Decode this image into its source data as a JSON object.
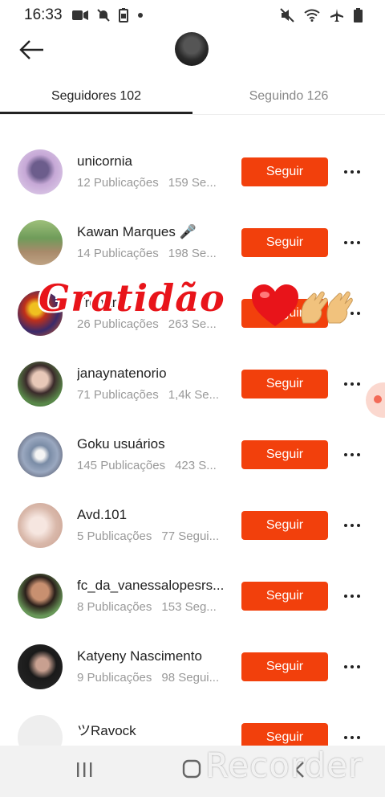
{
  "status_bar": {
    "time": "16:33"
  },
  "tabs": {
    "followers": "Seguidores 102",
    "following": "Seguindo 126"
  },
  "users": [
    {
      "name": "unicornia",
      "posts": "12 Publicações",
      "followers": "159 Se..."
    },
    {
      "name": "Kawan Marques 🎤",
      "posts": "14 Publicações",
      "followers": "198 Se..."
    },
    {
      "name": "Tremtr!",
      "posts": "26 Publicações",
      "followers": "263 Se..."
    },
    {
      "name": "janaynatenorio",
      "posts": "71 Publicações",
      "followers": "1,4k Se..."
    },
    {
      "name": "Goku usuários",
      "posts": "145 Publicações",
      "followers": "423 S..."
    },
    {
      "name": "Avd.101",
      "posts": "5 Publicações",
      "followers": "77 Segui..."
    },
    {
      "name": "fc_da_vanessalopesrs...",
      "posts": "8 Publicações",
      "followers": "153 Seg..."
    },
    {
      "name": "Katyeny Nascimento",
      "posts": "9 Publicações",
      "followers": "98 Segui..."
    },
    {
      "name": "ツRavock",
      "posts": "",
      "followers": ""
    }
  ],
  "follow_label": "Seguir",
  "overlay_text": "Gratidão",
  "watermark": "Recorder",
  "colors": {
    "accent": "#f2400c",
    "overlay_red": "#e8141a"
  },
  "icons": {
    "status": [
      "video-camera-icon",
      "notifications-off-icon",
      "battery-saver-icon",
      "dot-icon",
      "mute-icon",
      "wifi-icon",
      "airplane-icon",
      "battery-icon"
    ],
    "header": [
      "back-arrow-icon",
      "profile-avatar"
    ],
    "row": [
      "more-dots-icon"
    ],
    "nav": [
      "recent-apps-icon",
      "home-icon",
      "back-icon"
    ]
  }
}
